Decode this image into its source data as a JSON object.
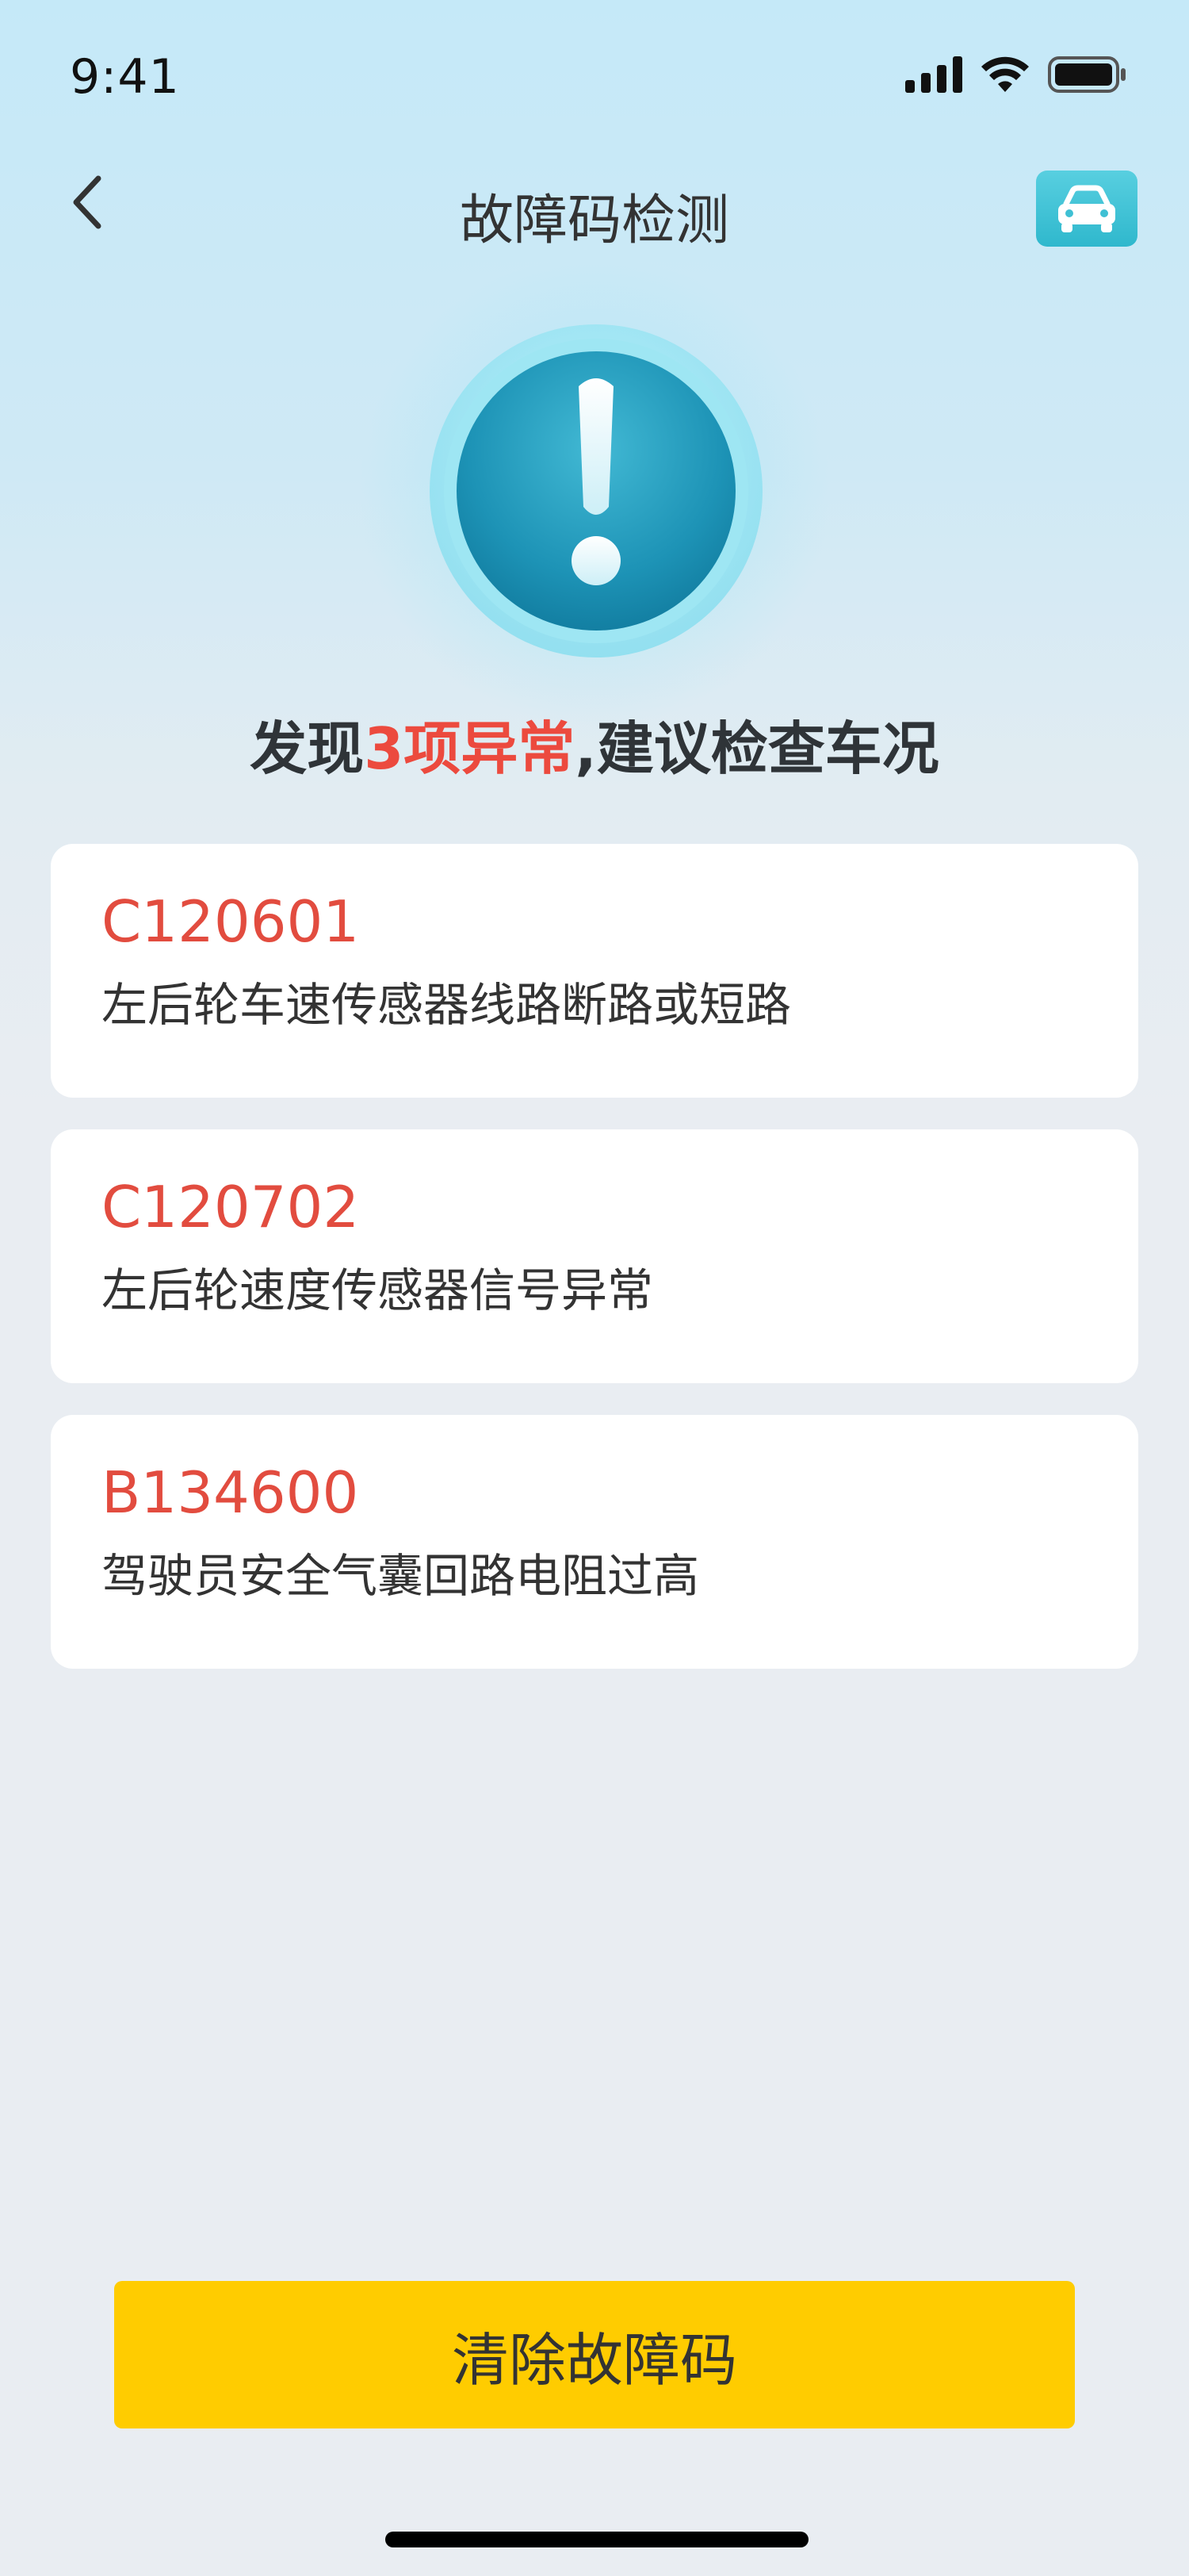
{
  "status_bar": {
    "time": "9:41",
    "icons": [
      "cellular-signal-icon",
      "wifi-icon",
      "battery-icon"
    ]
  },
  "nav": {
    "title": "故障码检测",
    "back_icon": "chevron-left-icon",
    "right_icon": "car-icon"
  },
  "alert": {
    "icon": "exclamation-icon"
  },
  "summary": {
    "prefix": "发现",
    "highlight": "3项异常",
    "suffix": ",建议检查车况"
  },
  "faults": [
    {
      "code": "C120601",
      "description": "左后轮车速传感器线路断路或短路"
    },
    {
      "code": "C120702",
      "description": "左后轮速度传感器信号异常"
    },
    {
      "code": "B134600",
      "description": "驾驶员安全气囊回路电阻过高"
    }
  ],
  "actions": {
    "clear_label": "清除故障码"
  },
  "colors": {
    "accent_yellow": "#ffcc00",
    "error_red": "#e24c3f",
    "teal": "#2fb8cd"
  }
}
